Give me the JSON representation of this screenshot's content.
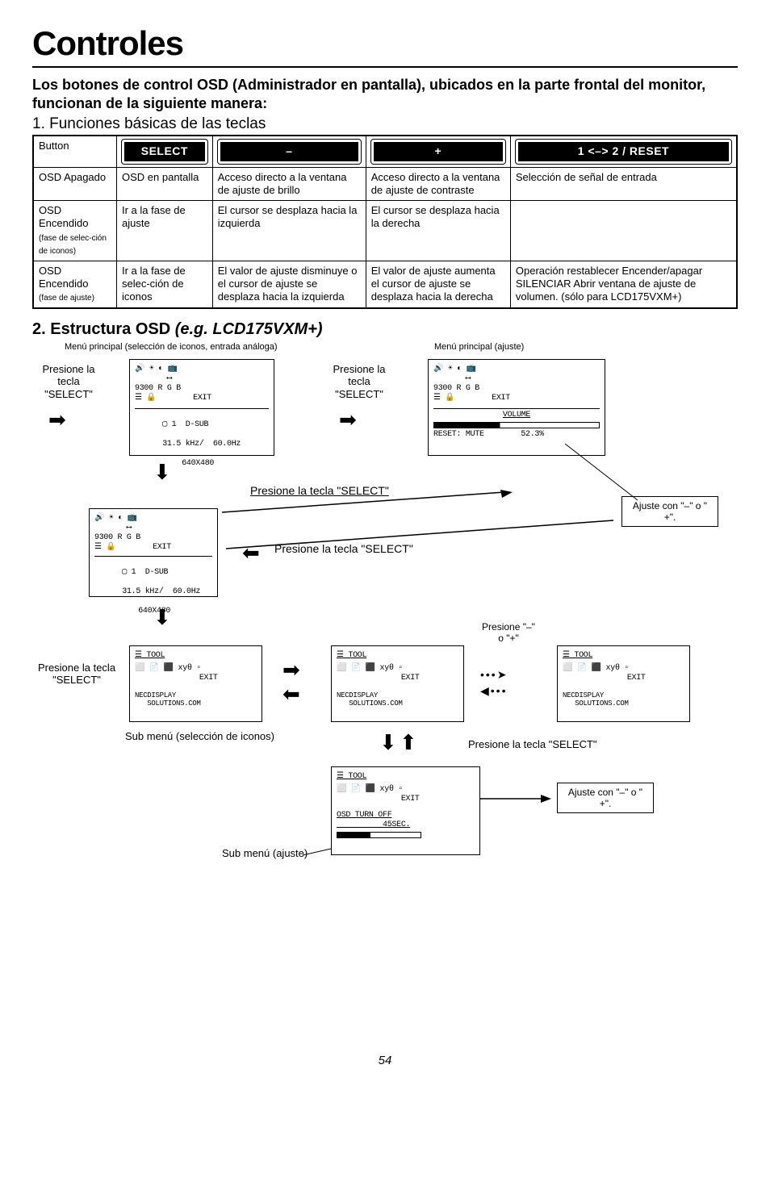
{
  "title": "Controles",
  "subtitle": "Los botones de control OSD (Administrador en pantalla), ubicados en la parte frontal del monitor, funcionan de la siguiente manera:",
  "step1": "1. Funciones básicas de las teclas",
  "table": {
    "head": {
      "c0": "Button",
      "c1": "SELECT",
      "c2": "–",
      "c3": "+",
      "c4": "1 <–> 2 / RESET"
    },
    "row1": {
      "c0": "OSD Apagado",
      "c1": "OSD en pantalla",
      "c2": "Acceso directo a la ventana de ajuste de brillo",
      "c3": "Acceso directo a la ventana de ajuste de contraste",
      "c4": "Selección de señal de entrada"
    },
    "row2": {
      "c0a": "OSD Encendido",
      "c0b": "(fase de selec-ción de iconos)",
      "c1": "Ir a la fase de ajuste",
      "c2": "El cursor se desplaza hacia la izquierda",
      "c3": "El cursor se desplaza hacia la derecha",
      "c4": ""
    },
    "row3": {
      "c0a": "OSD Encendido",
      "c0b": "(fase de ajuste)",
      "c1": "Ir a la fase de selec-ción de iconos",
      "c2": "El valor de ajuste disminuye o el cursor de ajuste se desplaza hacia la izquierda",
      "c3": "El valor de ajuste aumenta el cursor de ajuste se desplaza hacia la derecha",
      "c4": "Operación restablecer Encender/apagar SILENCIAR Abrir ventana de ajuste de volumen. (sólo para LCD175VXM+)"
    }
  },
  "section2_title_a": "2. Estructura OSD ",
  "section2_title_b": "(e.g. LCD175VXM+)",
  "cap_left": "Menú principal (selección de iconos, entrada análoga)",
  "cap_right": "Menú principal (ajuste)",
  "press_select": "Presione la tecla \"SELECT\"",
  "press_select_short": "Presione la tecla \"SELECT\"",
  "press_select_under": "Presione la tecla \"SELECT\"",
  "press_select_under2": "Presione la tecla \"SELECT\"",
  "adjust_hint": "Ajuste con \"–\" o \" +\".",
  "press_pm": "Presione \"–\" o \"+\"",
  "sub_sel": "Sub menú (selección de iconos)",
  "sub_adj": "Sub menú (ajuste)",
  "press_tecla_select": "Presione la tecla \"SELECT\"",
  "panel_main_line1": "▢ 1  D-SUB",
  "panel_main_line2": "31.5 kHz/  60.0Hz",
  "panel_main_line3": "640X480",
  "panel_vol_line1": "VOLUME",
  "panel_vol_line2": "RESET: MUTE        52.3%",
  "icon_row": "🔊 ☀ ◐ 📺\n       ⟷\n9300 R G B\n☰ 🔒        EXIT",
  "tool_title": "☰  TOOL",
  "tool_icons": "⬜ 📄 ⬛ xyθ ▫\n              EXIT",
  "tool_footer": "NECDISPLAY\n   SOLUTIONS.COM",
  "osd_turn": "OSD TURN OFF\n          45SEC.",
  "page": "54"
}
